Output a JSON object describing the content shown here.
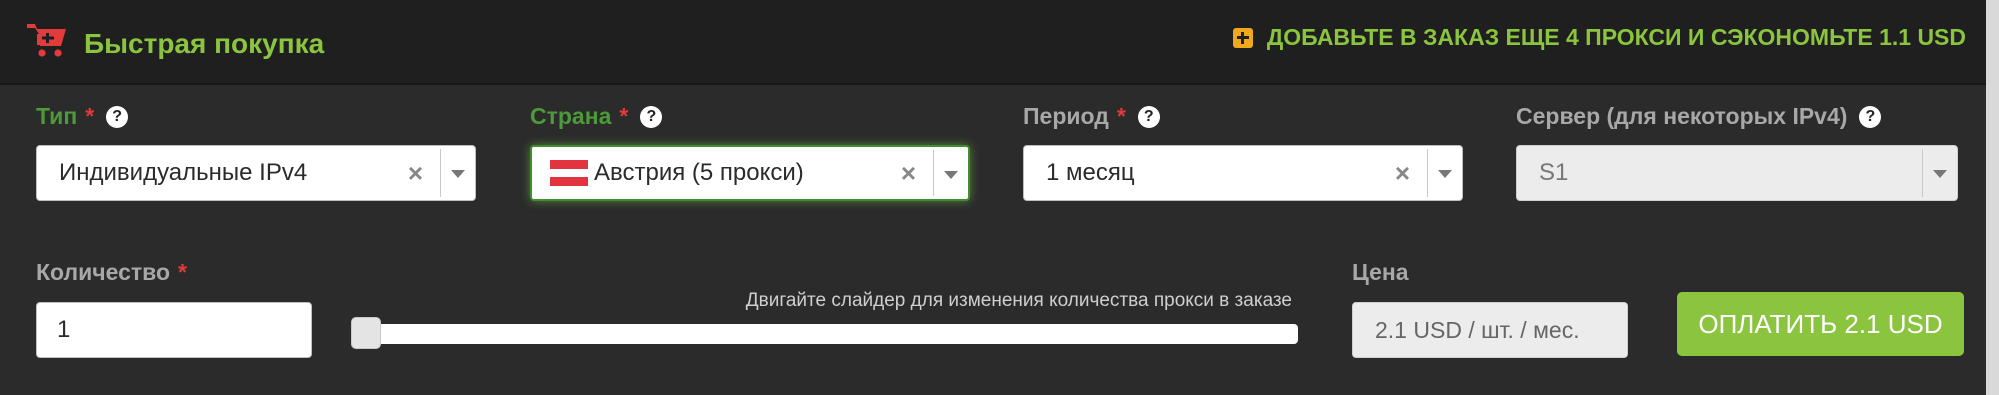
{
  "header": {
    "title": "Быстрая покупка",
    "title_icon": "shopping-cart-icon",
    "promo_icon": "plus-square-icon",
    "promo_text": "ДОБАВЬТЕ В ЗАКАЗ ЕЩЕ 4 ПРОКСИ И СЭКОНОМЬТЕ 1.1 USD"
  },
  "colors": {
    "accent_green": "#8bc43f",
    "label_green": "#4d9a3a",
    "required_red": "#e03a3a",
    "promo_icon_orange": "#f0a81c"
  },
  "fields": {
    "type": {
      "label": "Тип",
      "required": "*",
      "value": "Индивидуальные IPv4"
    },
    "country": {
      "label": "Страна",
      "required": "*",
      "value": "Австрия (5 прокси)",
      "flag_icon": "austria-flag-icon"
    },
    "period": {
      "label": "Период",
      "required": "*",
      "value": "1 месяц"
    },
    "server": {
      "label": "Сервер (для некоторых IPv4)",
      "value": "S1"
    },
    "quantity": {
      "label": "Количество",
      "required": "*",
      "value": "1"
    }
  },
  "help_glyph": "?",
  "clear_glyph": "×",
  "slider": {
    "hint": "Двигайте слайдер для изменения количества прокси в заказе",
    "position_fraction": 0
  },
  "price": {
    "label": "Цена",
    "value": "2.1 USD / шт. / мес."
  },
  "pay_button": {
    "label": "ОПЛАТИТЬ 2.1 USD"
  }
}
